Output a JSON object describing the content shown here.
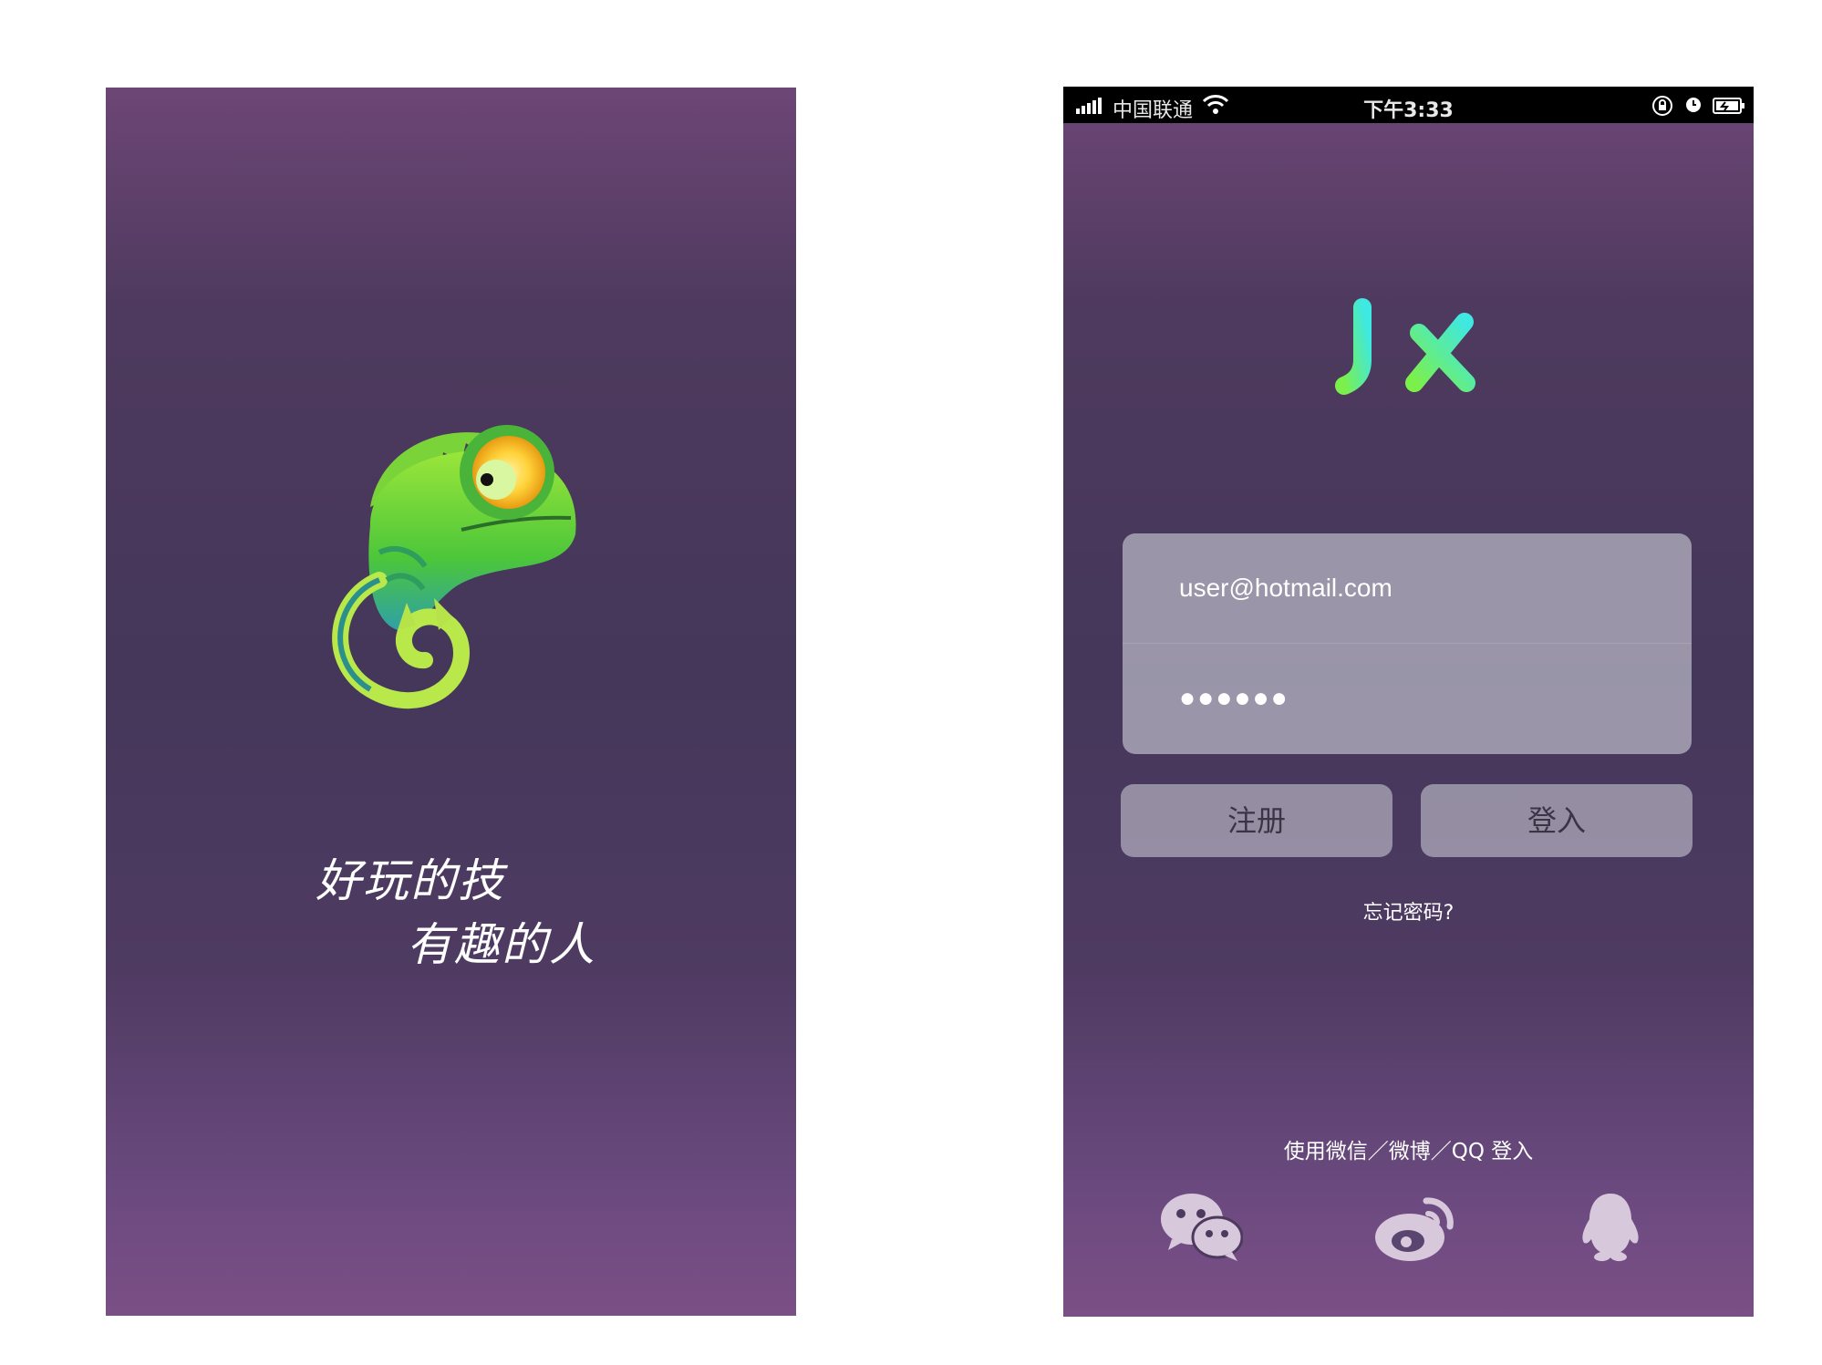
{
  "splash": {
    "slogan_line1": "好玩的技",
    "slogan_line2": "有趣的人",
    "mascot_icon": "chameleon-icon"
  },
  "status_bar": {
    "carrier": "中国联通",
    "time": "下午3:33"
  },
  "login": {
    "logo_icon": "ji-logo-icon",
    "email_value": "user@hotmail.com",
    "password_value": "●●●●●●",
    "register_label": "注册",
    "login_label": "登入",
    "forgot_label": "忘记密码?",
    "social_label": "使用微信／微博／QQ 登入",
    "social_icons": [
      "wechat-icon",
      "weibo-icon",
      "qq-icon"
    ]
  },
  "colors": {
    "bg_top": "#6d4676",
    "bg_mid": "#44375a",
    "bg_bottom": "#7a4f86",
    "logo_green": "#7cf04a",
    "logo_cyan": "#3fe8d8"
  }
}
